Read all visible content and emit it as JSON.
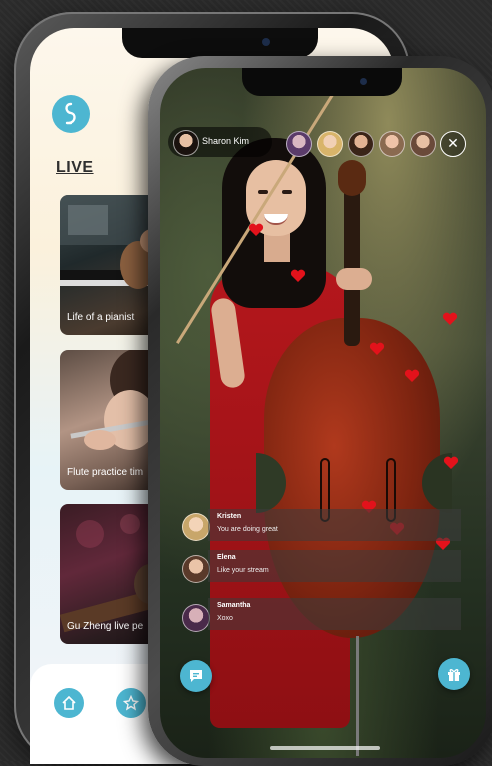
{
  "back_screen": {
    "section_title": "LIVE",
    "cards": [
      {
        "caption": "Life of a pianist"
      },
      {
        "caption": "Flute practice tim"
      },
      {
        "caption": "Gu Zheng live pe"
      }
    ],
    "nav": [
      {
        "icon": "home-icon"
      },
      {
        "icon": "star-icon"
      }
    ]
  },
  "stream": {
    "host_name": "Sharon Kim",
    "viewer_avatars": [
      "viewer-1",
      "viewer-2",
      "viewer-3",
      "viewer-4",
      "viewer-5"
    ],
    "close_symbol": "✕",
    "comments": [
      {
        "name": "Kristen",
        "text": "You are doing great"
      },
      {
        "name": "Elena",
        "text": "Like your stream"
      },
      {
        "name": "Samantha",
        "text": "Xoxo"
      }
    ],
    "chat_button_icon": "chat-icon",
    "gift_button_icon": "gift-icon"
  },
  "colors": {
    "accent": "#4db6d1",
    "heart": "#e3121b",
    "dress": "#b4171c"
  }
}
